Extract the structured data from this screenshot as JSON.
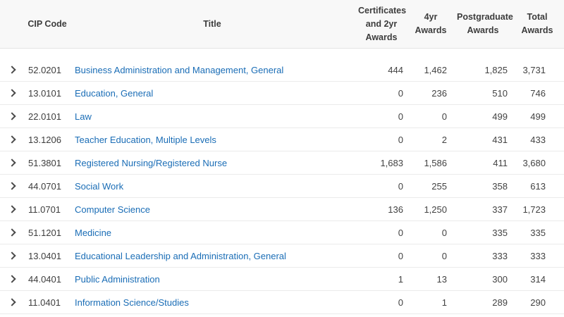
{
  "colors": {
    "link": "#1a6db6",
    "header_bg": "#f8f8f8"
  },
  "icons": {
    "expand_row": "chevron-right"
  },
  "table": {
    "columns": {
      "cip_code": "CIP Code",
      "title": "Title",
      "cert_2yr": "Certificates and 2yr Awards",
      "four_yr": "4yr Awards",
      "postgrad": "Postgraduate Awards",
      "total": "Total Awards"
    },
    "rows": [
      {
        "cip": "52.0201",
        "title": "Business Administration and Management, General",
        "cert": "444",
        "four": "1,462",
        "post": "1,825",
        "total": "3,731"
      },
      {
        "cip": "13.0101",
        "title": "Education, General",
        "cert": "0",
        "four": "236",
        "post": "510",
        "total": "746"
      },
      {
        "cip": "22.0101",
        "title": "Law",
        "cert": "0",
        "four": "0",
        "post": "499",
        "total": "499"
      },
      {
        "cip": "13.1206",
        "title": "Teacher Education, Multiple Levels",
        "cert": "0",
        "four": "2",
        "post": "431",
        "total": "433"
      },
      {
        "cip": "51.3801",
        "title": "Registered Nursing/Registered Nurse",
        "cert": "1,683",
        "four": "1,586",
        "post": "411",
        "total": "3,680"
      },
      {
        "cip": "44.0701",
        "title": "Social Work",
        "cert": "0",
        "four": "255",
        "post": "358",
        "total": "613"
      },
      {
        "cip": "11.0701",
        "title": "Computer Science",
        "cert": "136",
        "four": "1,250",
        "post": "337",
        "total": "1,723"
      },
      {
        "cip": "51.1201",
        "title": "Medicine",
        "cert": "0",
        "four": "0",
        "post": "335",
        "total": "335"
      },
      {
        "cip": "13.0401",
        "title": "Educational Leadership and Administration, General",
        "cert": "0",
        "four": "0",
        "post": "333",
        "total": "333"
      },
      {
        "cip": "44.0401",
        "title": "Public Administration",
        "cert": "1",
        "four": "13",
        "post": "300",
        "total": "314"
      },
      {
        "cip": "11.0401",
        "title": "Information Science/Studies",
        "cert": "0",
        "four": "1",
        "post": "289",
        "total": "290"
      }
    ]
  }
}
